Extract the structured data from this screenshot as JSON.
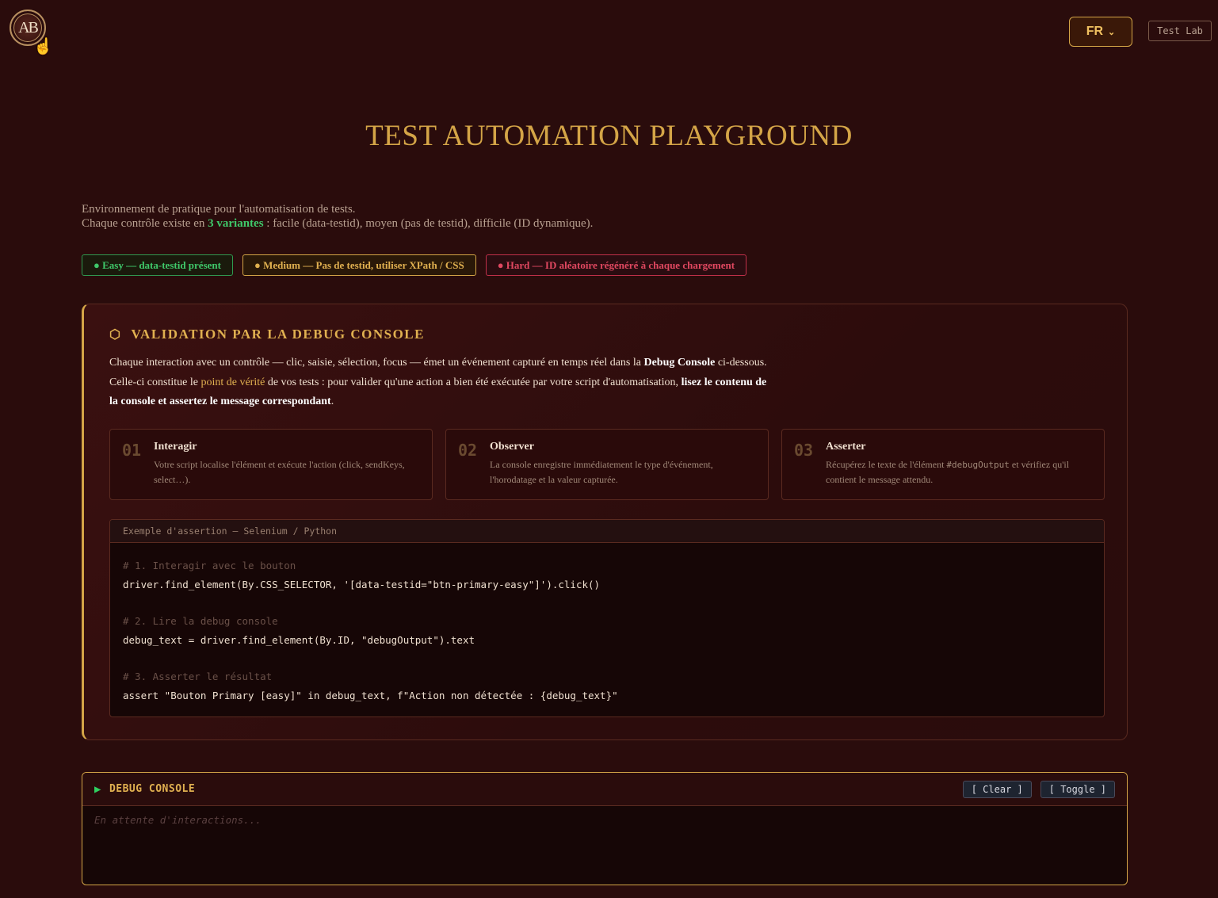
{
  "header": {
    "logo_text": "AB",
    "language": "FR",
    "test_lab_label": "Test Lab"
  },
  "title": "TEST AUTOMATION PLAYGROUND",
  "intro": {
    "line1": "Environnement de pratique pour l'automatisation de tests.",
    "line2_prefix": "Chaque contrôle existe en ",
    "line2_highlight": "3 variantes",
    "line2_suffix": " : facile (data-testid), moyen (pas de testid), difficile (ID dynamique)."
  },
  "badges": {
    "easy": "● Easy — data-testid présent",
    "medium": "● Medium — Pas de testid, utiliser XPath / CSS",
    "hard": "● Hard — ID aléatoire régénéré à chaque chargement"
  },
  "validation": {
    "title": "VALIDATION PAR LA DEBUG CONSOLE",
    "desc_1": "Chaque interaction avec un contrôle — clic, saisie, sélection, focus — émet un événement capturé en temps réel dans la ",
    "desc_bold_1": "Debug Console",
    "desc_2": " ci-dessous. Celle-ci constitue le ",
    "desc_gold": "point de vérité",
    "desc_3": " de vos tests : pour valider qu'une action a bien été exécutée par votre script d'automatisation, ",
    "desc_bold_2": "lisez le contenu de la console et assertez le message correspondant",
    "desc_4": ".",
    "steps": [
      {
        "num": "01",
        "title": "Interagir",
        "desc": "Votre script localise l'élément et exécute l'action (click, sendKeys, select…)."
      },
      {
        "num": "02",
        "title": "Observer",
        "desc": "La console enregistre immédiatement le type d'événement, l'horodatage et la valeur capturée."
      },
      {
        "num": "03",
        "title": "Asserter",
        "desc_prefix": "Récupérez le texte de l'élément ",
        "desc_code": "#debugOutput",
        "desc_suffix": " et vérifiez qu'il contient le message attendu."
      }
    ],
    "code": {
      "header": "Exemple d'assertion — Selenium / Python",
      "comment_1": "# 1. Interagir avec le bouton",
      "line_1": "driver.find_element(By.CSS_SELECTOR, '[data-testid=\"btn-primary-easy\"]').click()",
      "comment_2": "# 2. Lire la debug console",
      "line_2": "debug_text = driver.find_element(By.ID, \"debugOutput\").text",
      "comment_3": "# 3. Asserter le résultat",
      "line_3": "assert \"Bouton Primary [easy]\" in debug_text, f\"Action non détectée : {debug_text}\""
    }
  },
  "console": {
    "title": "DEBUG CONSOLE",
    "clear_label": "[ Clear ]",
    "toggle_label": "[ Toggle ]",
    "placeholder": "En attente d'interactions..."
  },
  "colors": {
    "background": "#2a0c0c",
    "gold": "#d4a547",
    "easy": "#3fc86a",
    "medium": "#e0b050",
    "hard": "#e04860"
  },
  "icons": [
    "logo-icon",
    "chevron-down-icon",
    "hexagon-icon",
    "play-icon"
  ]
}
